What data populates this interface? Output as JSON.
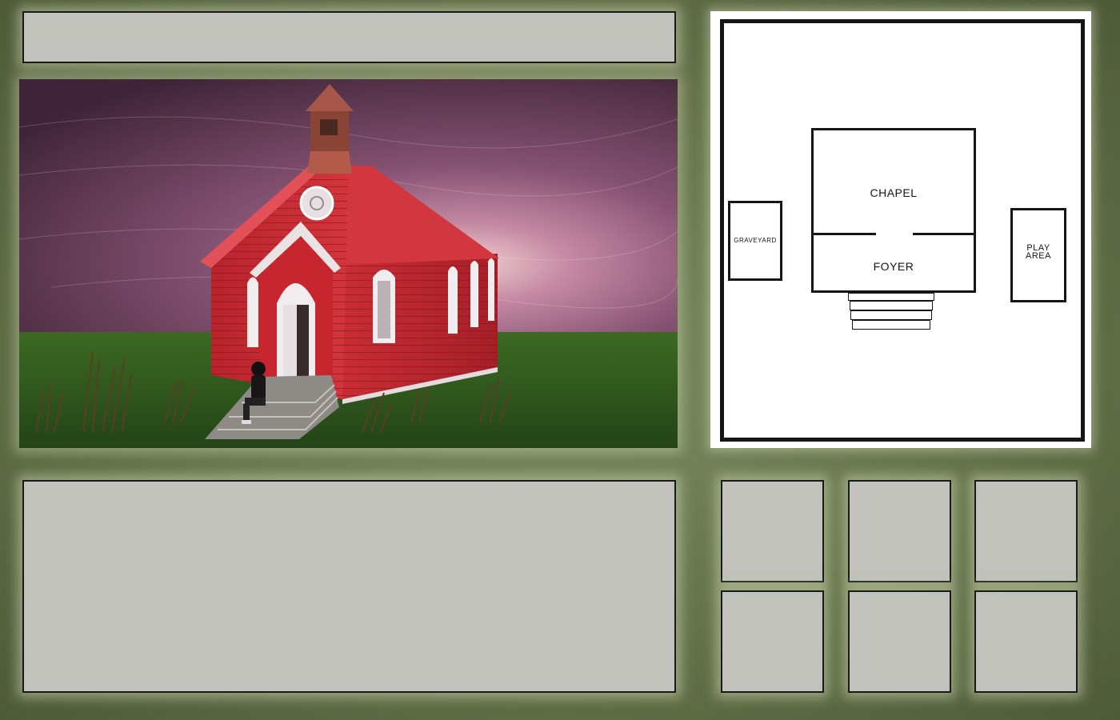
{
  "map": {
    "chapel_label": "CHAPEL",
    "foyer_label": "FOYER",
    "graveyard_label": "GRAVEYARD",
    "play_area_label_line1": "PLAY",
    "play_area_label_line2": "AREA"
  },
  "colors": {
    "frame_background": "#5c6a45",
    "panel_fill": "#c0c2bb",
    "panel_glow": "#cdd7af",
    "church_red": "#c22b33",
    "sky_purple": "#6a3b55",
    "grass_green": "#2f5a1c"
  },
  "inventory": {
    "slots": [
      "",
      "",
      "",
      "",
      "",
      ""
    ]
  }
}
